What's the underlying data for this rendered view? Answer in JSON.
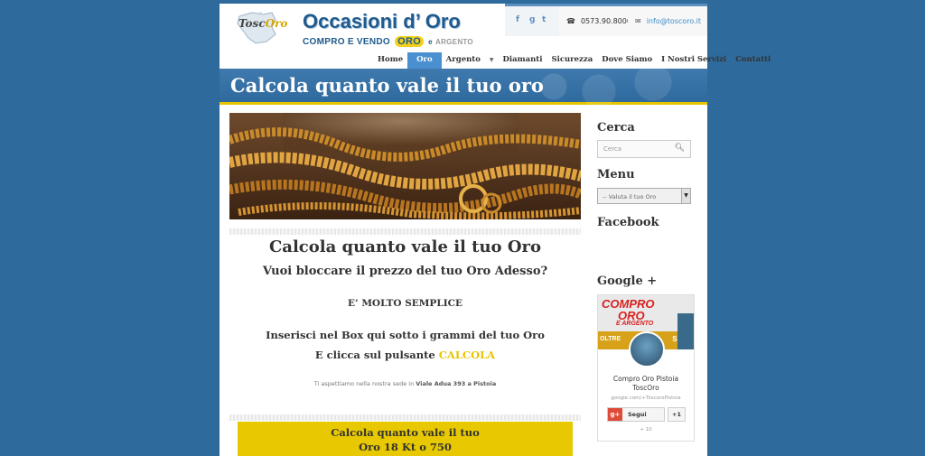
{
  "header": {
    "logo_text_1": "Tosc",
    "logo_text_2": "Oro",
    "site_title": "Occasioni d’ Oro",
    "tagline_1": "COMPRO E VENDO",
    "tagline_oro": "ORO",
    "tagline_e": "e",
    "tagline_argento": "ARGENTO",
    "phone": "0573.90.8000",
    "email": "info@toscoro.it",
    "social": [
      "f",
      "g",
      "t"
    ]
  },
  "nav": {
    "items": [
      {
        "label": "Home"
      },
      {
        "label": "Oro",
        "active": true
      },
      {
        "label": "Argento",
        "dropdown": true
      },
      {
        "label": "Diamanti"
      },
      {
        "label": "Sicurezza"
      },
      {
        "label": "Dove Siamo"
      },
      {
        "label": "I Nostri Servizi"
      },
      {
        "label": "Contatti"
      }
    ]
  },
  "page_title": "Calcola quanto vale il tuo oro",
  "content": {
    "h1": "Calcola quanto vale il tuo Oro",
    "h2": "Vuoi bloccare il prezzo del tuo Oro Adesso?",
    "h3": "E’ MOLTO SEMPLICE",
    "p1": "Inserisci nel Box qui sotto i grammi del tuo Oro",
    "p2_prefix": "E clicca sul pulsante",
    "p2_highlight": "CALCOLA",
    "small_prefix": "Ti aspettiamo nella nostra sede in",
    "small_address": "Viale Adua 393 a Pistoia",
    "calc_title_1": "Calcola quanto vale il tuo",
    "calc_title_2": "Oro 18 Kt o 750"
  },
  "sidebar": {
    "search_heading": "Cerca",
    "search_placeholder": "Cerca",
    "menu_heading": "Menu",
    "menu_selected": "-- Valuta il tuo Oro",
    "facebook_heading": "Facebook",
    "gplus_heading": "Google +",
    "gplus": {
      "banner_line_1": "COMPRO",
      "banner_line_2": "ORO",
      "banner_line_3": "E ARGENTO",
      "banner_line_4": "OLTRE",
      "banner_line_5": "SIONI",
      "name_1": "Compro Oro Pistoia",
      "name_2": "ToscOro",
      "url": "google.com/+ToscoroPistoia",
      "follow_label": "Segui",
      "plus_one_label": "+1",
      "count": "+ 10"
    }
  },
  "colors": {
    "background": "#2e6a9c",
    "accent_blue": "#4a8fcf",
    "gold": "#e8c800"
  }
}
